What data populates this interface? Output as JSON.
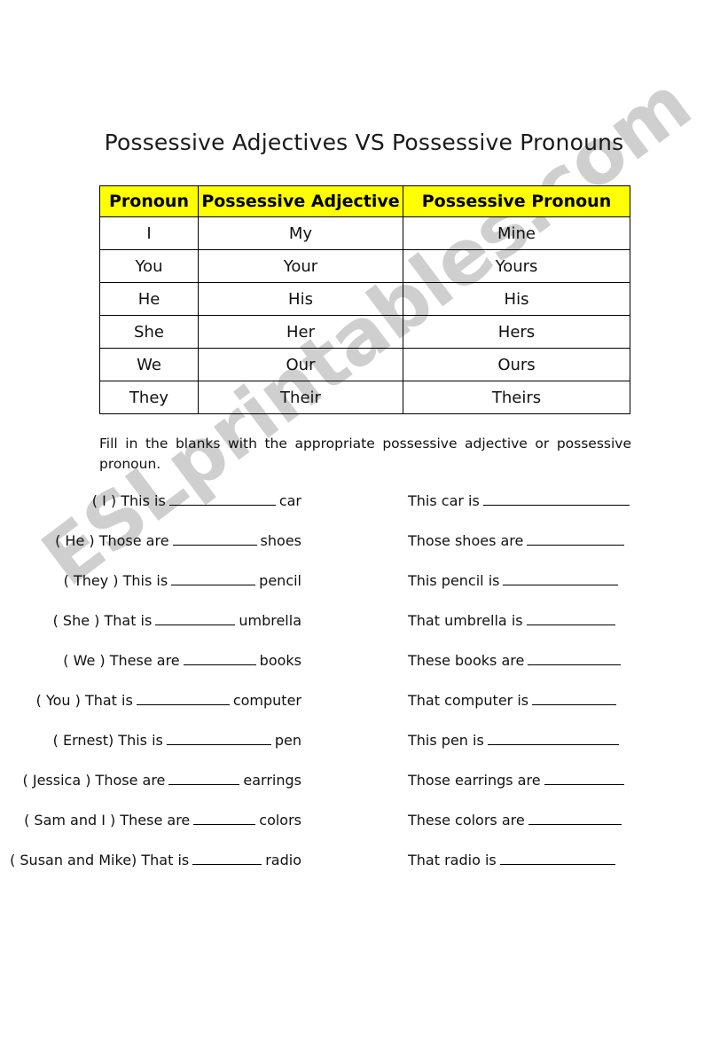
{
  "document": {
    "title": "Possessive Adjectives VS Possessive Pronouns",
    "watermark": "ESLprintables.com",
    "accent_color": "#ffff00",
    "text_color": "#000000"
  },
  "table": {
    "headers": [
      "Pronoun",
      "Possessive Adjective",
      "Possessive Pronoun"
    ],
    "rows": [
      {
        "pronoun": "I",
        "adjective": "My",
        "possessive": "Mine"
      },
      {
        "pronoun": "You",
        "adjective": "Your",
        "possessive": "Yours"
      },
      {
        "pronoun": "He",
        "adjective": "His",
        "possessive": "His"
      },
      {
        "pronoun": "She",
        "adjective": "Her",
        "possessive": "Hers"
      },
      {
        "pronoun": "We",
        "adjective": "Our",
        "possessive": "Ours"
      },
      {
        "pronoun": "They",
        "adjective": "Their",
        "possessive": "Theirs"
      }
    ]
  },
  "instructions": "Fill in the blanks with the appropriate possessive adjective or possessive pronoun.",
  "exercises": [
    {
      "cue": "( I ) This is",
      "noun": "car",
      "blank_width": 120,
      "right_text": "This car is",
      "right_blank_width": 165
    },
    {
      "cue": "( He ) Those are",
      "noun": "shoes",
      "blank_width": 95,
      "right_text": "Those shoes are",
      "right_blank_width": 110
    },
    {
      "cue": "( They ) This is",
      "noun": "pencil",
      "blank_width": 95,
      "right_text": "This pencil is",
      "right_blank_width": 130
    },
    {
      "cue": "( She ) That is",
      "noun": "umbrella",
      "blank_width": 90,
      "right_text": "That umbrella is",
      "right_blank_width": 100
    },
    {
      "cue": "( We ) These are",
      "noun": "books",
      "blank_width": 82,
      "right_text": "These books are",
      "right_blank_width": 105
    },
    {
      "cue": "( You ) That is",
      "noun": "computer",
      "blank_width": 105,
      "right_text": "That computer is",
      "right_blank_width": 95
    },
    {
      "cue": "( Ernest) This is",
      "noun": "pen",
      "blank_width": 118,
      "right_text": "This pen is",
      "right_blank_width": 148
    },
    {
      "cue": "( Jessica ) Those are",
      "noun": "earrings",
      "blank_width": 80,
      "right_text": "Those earrings are",
      "right_blank_width": 90
    },
    {
      "cue": "( Sam and I ) These are",
      "noun": "colors",
      "blank_width": 70,
      "right_text": "These colors are",
      "right_blank_width": 105
    },
    {
      "cue": "( Susan and Mike) That is",
      "noun": "radio",
      "blank_width": 78,
      "right_text": "That radio is",
      "right_blank_width": 130
    }
  ]
}
